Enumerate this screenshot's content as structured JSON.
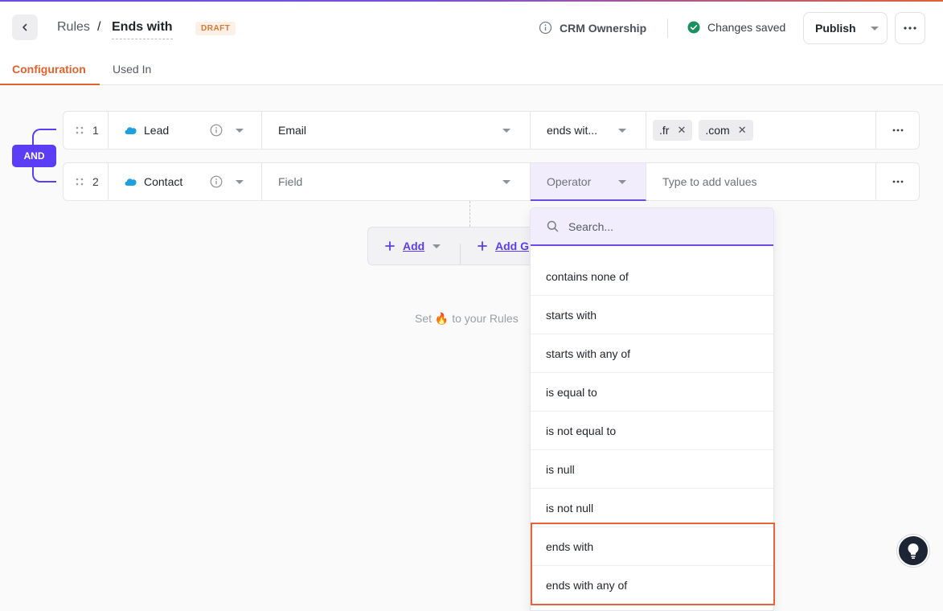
{
  "header": {
    "breadcrumb_parent": "Rules",
    "breadcrumb_sep": "/",
    "title": "Ends with",
    "status_badge": "DRAFT",
    "crm_label": "CRM Ownership",
    "saved_text": "Changes saved",
    "publish_label": "Publish"
  },
  "tabs": [
    {
      "label": "Configuration",
      "active": true
    },
    {
      "label": "Used In",
      "active": false
    }
  ],
  "logic": {
    "operator": "AND"
  },
  "rules": [
    {
      "index": "1",
      "object": "Lead",
      "field": "Email",
      "operator": "ends wit...",
      "values": [
        ".fr",
        ".com"
      ],
      "value_placeholder": ""
    },
    {
      "index": "2",
      "object": "Contact",
      "field": "Field",
      "operator": "Operator",
      "values": [],
      "value_placeholder": "Type to add values"
    }
  ],
  "add_buttons": {
    "add": "Add",
    "add_group": "Add G"
  },
  "empty_hint": {
    "before": "Set",
    "emoji": "🔥",
    "after": "to your Rules"
  },
  "operator_dropdown": {
    "search_placeholder": "Search...",
    "options": [
      "contains none of",
      "starts with",
      "starts with any of",
      "is equal to",
      "is not equal to",
      "is null",
      "is not null",
      "ends with",
      "ends with any of"
    ],
    "highlighted": [
      "ends with",
      "ends with any of"
    ]
  },
  "colors": {
    "accent": "#5b3df5",
    "tab_active": "#e0632e",
    "highlight_border": "#e8623b",
    "saved_check": "#1a8f5f",
    "salesforce_cloud": "#1ea0dc"
  },
  "icons": {
    "back": "chevron-left-icon",
    "info": "info-icon",
    "saved": "check-circle-icon",
    "more": "more-horizontal-icon",
    "drag": "drag-handle-icon",
    "object": "salesforce-cloud-icon",
    "search": "search-icon",
    "add": "plus-icon",
    "help": "lightbulb-icon"
  }
}
